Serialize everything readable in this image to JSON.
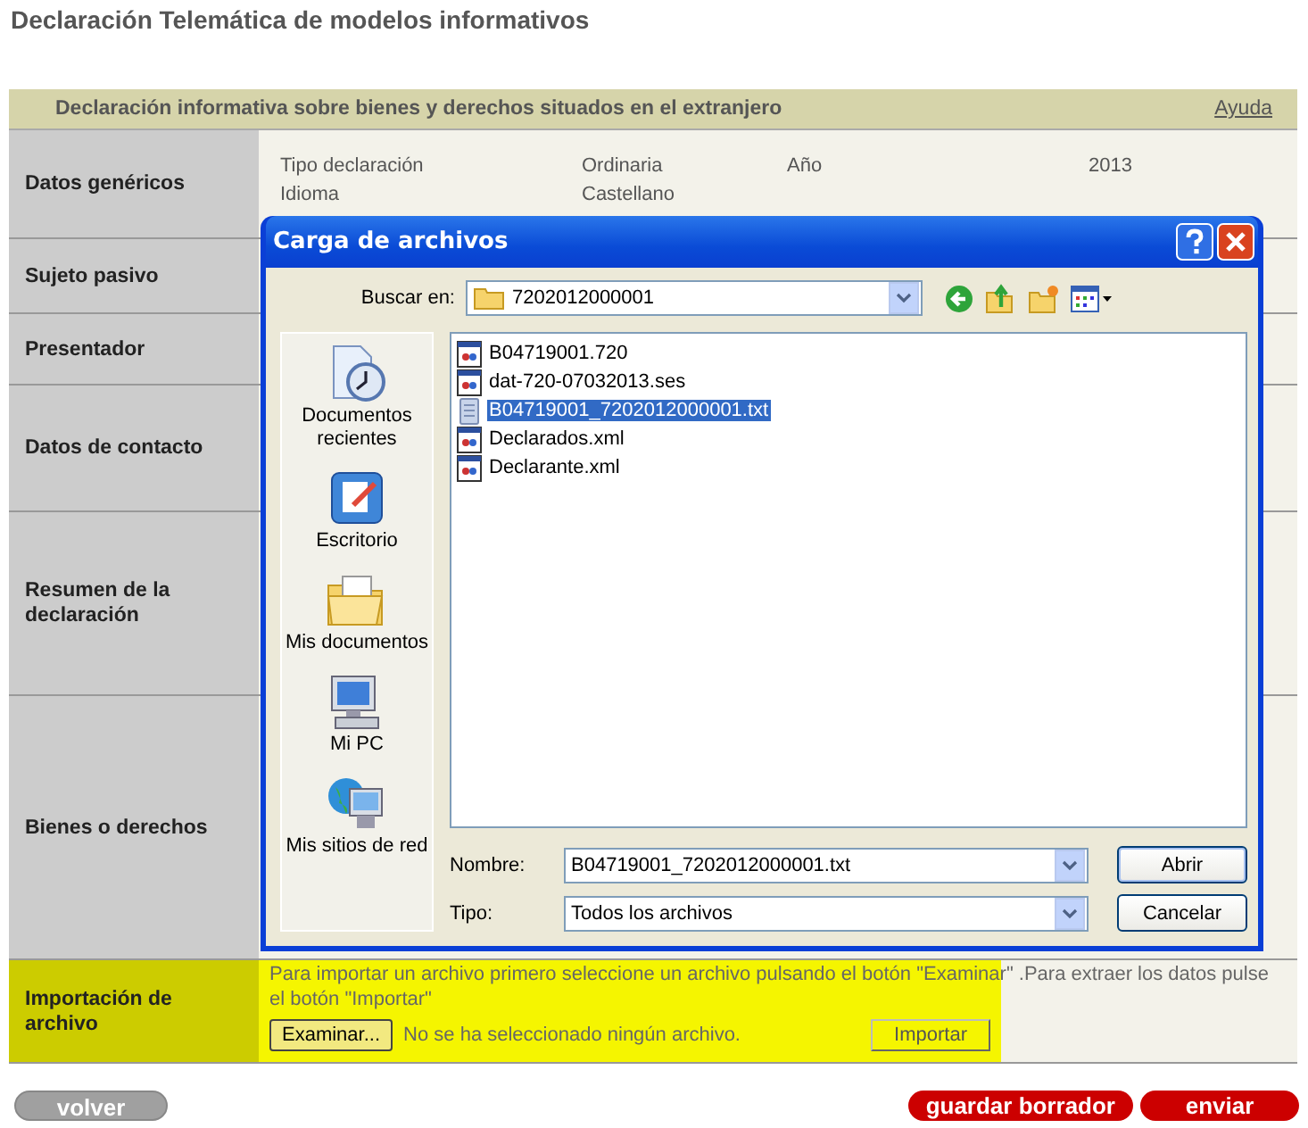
{
  "page_title": "Declaración Telemática de modelos informativos",
  "section": {
    "title": "Declaración informativa sobre bienes y derechos situados en el extranjero",
    "help_link": "Ayuda"
  },
  "rows": [
    {
      "label": "Datos genéricos",
      "kind": "fields",
      "fields": [
        {
          "label": "Tipo declaración",
          "value": "Ordinaria"
        },
        {
          "label": "Año",
          "value": "2013"
        },
        {
          "label": "Idioma",
          "value": "Castellano"
        }
      ]
    },
    {
      "label": "Sujeto pasivo",
      "kind": "empty"
    },
    {
      "label": "Presentador",
      "kind": "empty"
    },
    {
      "label": "Datos de contacto",
      "kind": "empty"
    },
    {
      "label": "Resumen de la declaración",
      "kind": "empty"
    },
    {
      "label": "Bienes o derechos",
      "kind": "empty"
    },
    {
      "label": "Importación de archivo",
      "kind": "import",
      "highlighted": true
    }
  ],
  "import": {
    "instructions": "Para importar un archivo primero seleccione un archivo pulsando el botón \"Examinar\" .Para extraer los datos pulse el botón \"Importar\"",
    "browse_button": "Examinar...",
    "status": "No se ha seleccionado ningún archivo.",
    "import_button": "Importar"
  },
  "dialog": {
    "title": "Carga de archivos",
    "look_in_label": "Buscar en:",
    "look_in_value": "7202012000001",
    "places": [
      {
        "label": "Documentos recientes",
        "kind": "recent"
      },
      {
        "label": "Escritorio",
        "kind": "desktop"
      },
      {
        "label": "Mis documentos",
        "kind": "documents"
      },
      {
        "label": "Mi PC",
        "kind": "computer"
      },
      {
        "label": "Mis sitios de red",
        "kind": "network"
      }
    ],
    "files": [
      {
        "name": "B04719001.720",
        "kind": "app",
        "selected": false
      },
      {
        "name": "dat-720-07032013.ses",
        "kind": "app",
        "selected": false
      },
      {
        "name": "B04719001_7202012000001.txt",
        "kind": "text",
        "selected": true
      },
      {
        "name": "Declarados.xml",
        "kind": "app",
        "selected": false
      },
      {
        "name": "Declarante.xml",
        "kind": "app",
        "selected": false
      }
    ],
    "filename_label": "Nombre:",
    "filename": "B04719001_7202012000001.txt",
    "type_label": "Tipo:",
    "type": "Todos los archivos",
    "buttons": [
      {
        "label": "Abrir",
        "default": true
      },
      {
        "label": "Cancelar",
        "default": false
      }
    ]
  },
  "footer_buttons": [
    {
      "label": "volver",
      "kind": "secondary"
    },
    {
      "label": "guardar borrador",
      "kind": "primary"
    },
    {
      "label": "enviar",
      "kind": "primary"
    }
  ]
}
